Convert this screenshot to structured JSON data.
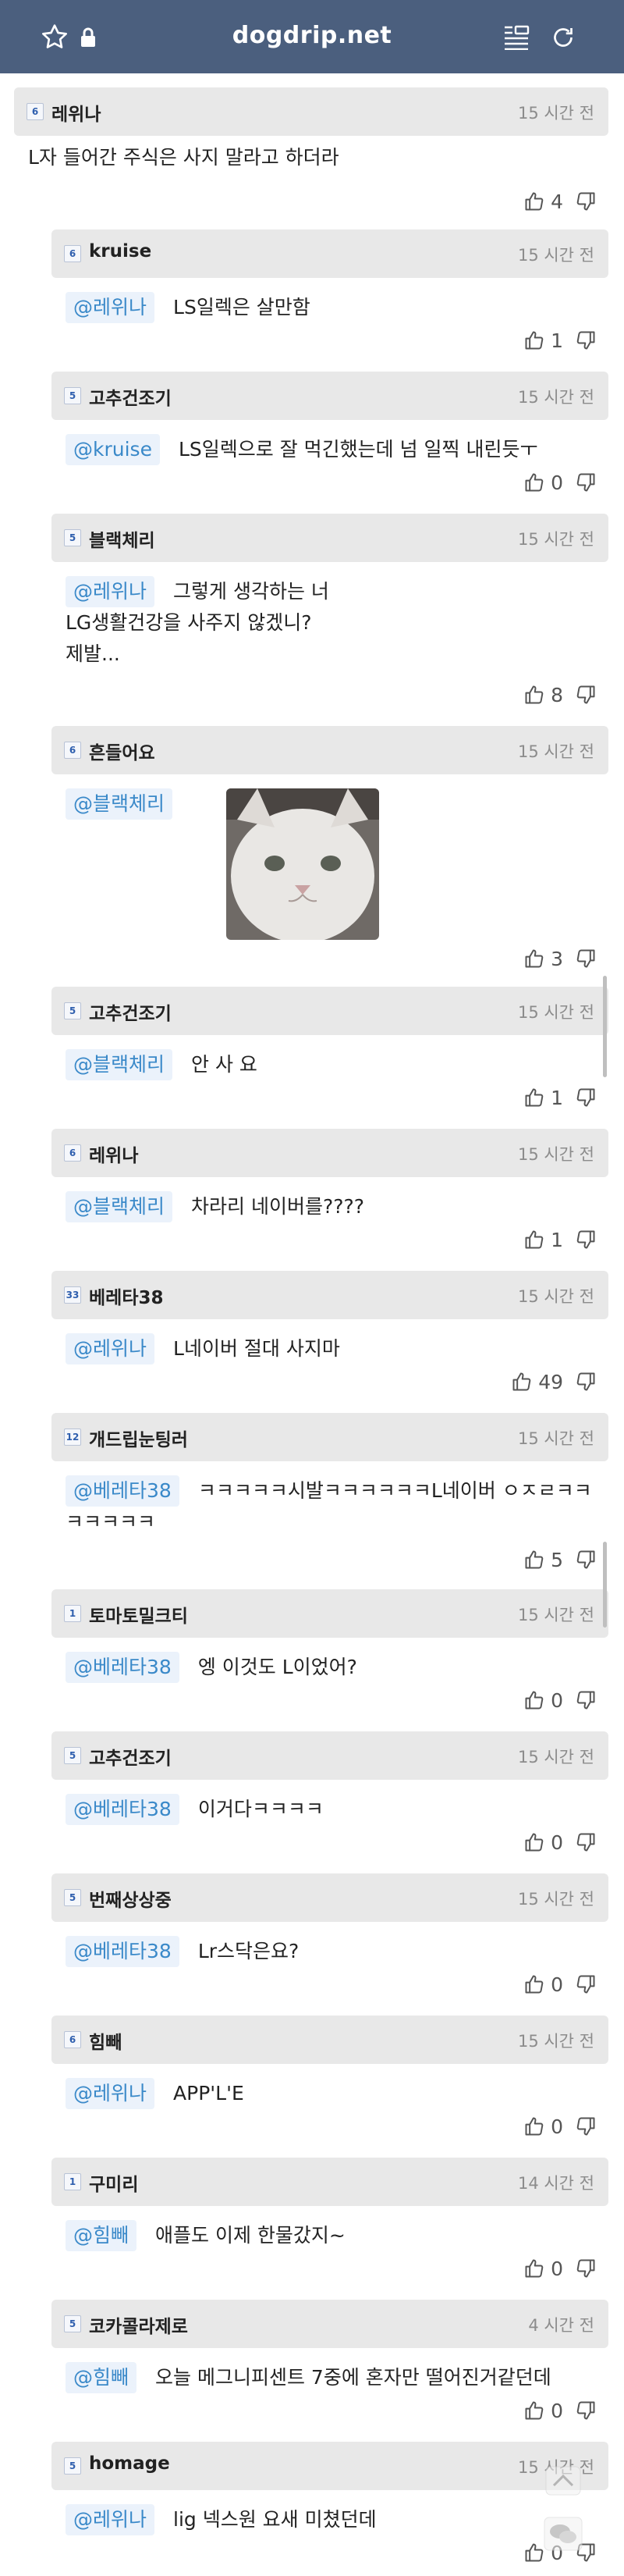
{
  "browser": {
    "url": "dogdrip.net"
  },
  "comments": [
    {
      "nick": "레위나",
      "level": "6",
      "time": "15 시간 전",
      "mention": "",
      "text": "L자 들어간 주식은 사지 말라고 하더라",
      "text2": "",
      "text3": "",
      "up": "4"
    },
    {
      "nick": "kruise",
      "level": "6",
      "time": "15 시간 전",
      "mention": "@레위나",
      "text": "LS일렉은 살만함",
      "text2": "",
      "text3": "",
      "up": "1"
    },
    {
      "nick": "고추건조기",
      "level": "5",
      "time": "15 시간 전",
      "mention": "@kruise",
      "text": "LS일렉으로 잘 먹긴했는데 넘 일찍 내린듯ㅜ",
      "text2": "",
      "text3": "",
      "up": "0"
    },
    {
      "nick": "블랙체리",
      "level": "5",
      "time": "15 시간 전",
      "mention": "@레위나",
      "text": "그렇게 생각하는 너",
      "text2": "LG생활건강을 사주지 않겠니?",
      "text3": "제발...",
      "up": "8"
    },
    {
      "nick": "흔들어요",
      "level": "6",
      "time": "15 시간 전",
      "mention": "@블랙체리",
      "text": "",
      "text2": "",
      "text3": "",
      "up": "3"
    },
    {
      "nick": "고추건조기",
      "level": "5",
      "time": "15 시간 전",
      "mention": "@블랙체리",
      "text": "안 사 요",
      "text2": "",
      "text3": "",
      "up": "1"
    },
    {
      "nick": "레위나",
      "level": "6",
      "time": "15 시간 전",
      "mention": "@블랙체리",
      "text": "차라리 네이버를????",
      "text2": "",
      "text3": "",
      "up": "1"
    },
    {
      "nick": "베레타38",
      "level": "33",
      "time": "15 시간 전",
      "mention": "@레위나",
      "text": "L네이버 절대 사지마",
      "text2": "",
      "text3": "",
      "up": "49"
    },
    {
      "nick": "개드립눈팅러",
      "level": "12",
      "time": "15 시간 전",
      "mention": "@베레타38",
      "text": "ㅋㅋㅋㅋㅋ시발ㅋㅋㅋㅋㅋㅋL네이버 ㅇㅈㄹㅋㅋ",
      "text2": "ㅋㅋㅋㅋㅋ",
      "text3": "",
      "up": "5"
    },
    {
      "nick": "토마토밀크티",
      "level": "1",
      "time": "15 시간 전",
      "mention": "@베레타38",
      "text": "엥 이것도 L이었어?",
      "text2": "",
      "text3": "",
      "up": "0"
    },
    {
      "nick": "고추건조기",
      "level": "5",
      "time": "15 시간 전",
      "mention": "@베레타38",
      "text": "이거다ㅋㅋㅋㅋ",
      "text2": "",
      "text3": "",
      "up": "0"
    },
    {
      "nick": "번째상상중",
      "level": "5",
      "time": "15 시간 전",
      "mention": "@베레타38",
      "text": "Lr스닥은요?",
      "text2": "",
      "text3": "",
      "up": "0"
    },
    {
      "nick": "힘빼",
      "level": "6",
      "time": "15 시간 전",
      "mention": "@레위나",
      "text": "APP'L'E",
      "text2": "",
      "text3": "",
      "up": "0"
    },
    {
      "nick": "구미리",
      "level": "1",
      "time": "14 시간 전",
      "mention": "@힘빼",
      "text": "애플도 이제 한물갔지~",
      "text2": "",
      "text3": "",
      "up": "0"
    },
    {
      "nick": "코카콜라제로",
      "level": "5",
      "time": "4 시간 전",
      "mention": "@힘빼",
      "text": "오늘 메그니피센트 7중에 혼자만 떨어진거같던데",
      "text2": "",
      "text3": "",
      "up": "0"
    },
    {
      "nick": "homage",
      "level": "5",
      "time": "15 시간 전",
      "mention": "@레위나",
      "text": "lig 넥스원 요새 미쳤던데",
      "text2": "",
      "text3": "",
      "up": "0"
    }
  ],
  "icons": {
    "thumb_up": "thumbs-up-icon",
    "thumb_down": "thumbs-down-icon",
    "scroll_top": "chevron-up-icon",
    "chat": "chat-bubbles-icon"
  },
  "colors": {
    "topbar": "#4b5f7e",
    "mention_text": "#3a89c9",
    "mention_bg": "#ebf2fb",
    "header_bg": "#e8e8e8"
  }
}
